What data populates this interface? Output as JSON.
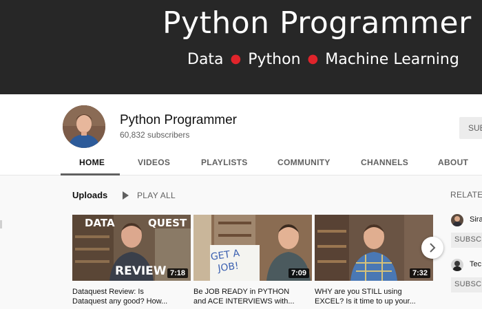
{
  "banner": {
    "title": "Python Programmer",
    "tagline": [
      "Data",
      "Python",
      "Machine Learning"
    ],
    "background": "#272727",
    "accent_dot_color": "#e0242b"
  },
  "channel": {
    "name": "Python Programmer",
    "subscribers": "60,832 subscribers",
    "subscribe_label": "SUBSCRIBE"
  },
  "tabs": [
    {
      "label": "HOME",
      "active": true
    },
    {
      "label": "VIDEOS",
      "active": false
    },
    {
      "label": "PLAYLISTS",
      "active": false
    },
    {
      "label": "COMMUNITY",
      "active": false
    },
    {
      "label": "CHANNELS",
      "active": false
    },
    {
      "label": "ABOUT",
      "active": false
    }
  ],
  "uploads": {
    "title": "Uploads",
    "play_all_label": "PLAY ALL",
    "videos": [
      {
        "title": "Dataquest Review: Is\nDataquest any good? How...",
        "duration": "7:18",
        "thumb_text": [
          "DATA",
          "QUEST",
          "REVIEW"
        ]
      },
      {
        "title": "Be JOB READY in PYTHON\nand ACE INTERVIEWS with...",
        "duration": "7:09",
        "thumb_text": [
          "GET A",
          "JOB!"
        ]
      },
      {
        "title": "WHY are you STILL using\nEXCEL? Is it time to up your...",
        "duration": "7:32",
        "thumb_text": []
      }
    ]
  },
  "related": {
    "title": "RELATED",
    "channels": [
      {
        "name": "Sira",
        "subscribe_label": "SUBSC"
      },
      {
        "name": "Tec",
        "subscribe_label": "SUBSC"
      }
    ]
  },
  "icons": {
    "play": "play-icon",
    "next": "chevron-right-icon"
  }
}
